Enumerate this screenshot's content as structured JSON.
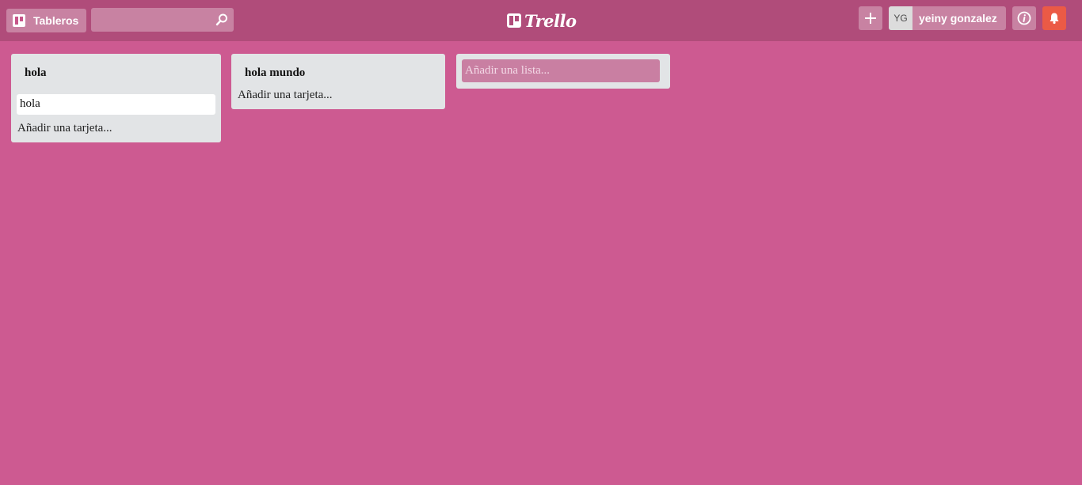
{
  "header": {
    "boards_label": "Tableros",
    "search_value": "",
    "logo_text": "Trello",
    "user_initials": "YG",
    "user_name": "yeiny gonzalez"
  },
  "lists": [
    {
      "title": "hola",
      "cards": [
        "hola"
      ],
      "add_card_label": "Añadir una tarjeta..."
    },
    {
      "title": "hola mundo",
      "cards": [],
      "add_card_label": "Añadir una tarjeta..."
    }
  ],
  "add_list": {
    "placeholder": "Añadir una lista..."
  },
  "colors": {
    "background": "#cd5a91",
    "header": "#b04c7a",
    "list": "#e2e4e6",
    "notification": "#eb5a46"
  },
  "icons": [
    "board-icon",
    "search-icon",
    "trello-logo-icon",
    "plus-icon",
    "info-icon",
    "bell-icon"
  ]
}
